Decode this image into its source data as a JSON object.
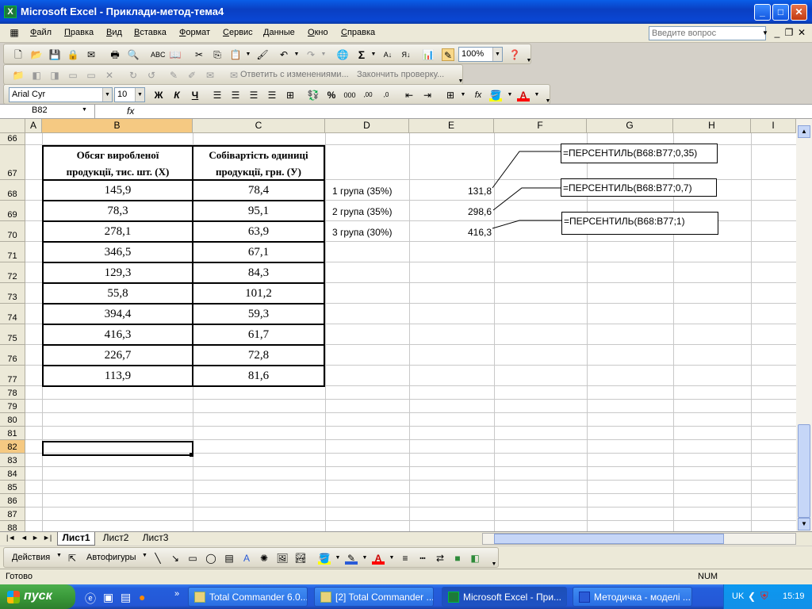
{
  "window": {
    "title": "Microsoft Excel - Приклади-метод-тема4",
    "app_icon": "excel-icon"
  },
  "menu": {
    "items": [
      "Файл",
      "Правка",
      "Вид",
      "Вставка",
      "Формат",
      "Сервис",
      "Данные",
      "Окно",
      "Справка"
    ],
    "help_placeholder": "Введите вопрос"
  },
  "toolbar": {
    "zoom": "100%",
    "review_reply": "Ответить с изменениями...",
    "review_end": "Закончить проверку...",
    "font": "Arial Cyr",
    "font_size": "10",
    "bold": "Ж",
    "italic": "К",
    "underline": "Ч",
    "fx": "fx"
  },
  "formula_bar": {
    "name_box": "B82",
    "content": ""
  },
  "columns": [
    "A",
    "B",
    "C",
    "D",
    "E",
    "F",
    "G",
    "H",
    "I"
  ],
  "rows": [
    "66",
    "67",
    "68",
    "69",
    "70",
    "71",
    "72",
    "73",
    "74",
    "75",
    "76",
    "77",
    "78",
    "79",
    "80",
    "81",
    "82",
    "83",
    "84",
    "85",
    "86",
    "87",
    "88"
  ],
  "table": {
    "header_b": [
      "Обсяг виробленої",
      "продукції, тис. шт. (Х)"
    ],
    "header_c": [
      "Собівартість одиниці",
      "продукції, грн. (У)"
    ],
    "rows": [
      [
        "145,9",
        "78,4"
      ],
      [
        "78,3",
        "95,1"
      ],
      [
        "278,1",
        "63,9"
      ],
      [
        "346,5",
        "67,1"
      ],
      [
        "129,3",
        "84,3"
      ],
      [
        "55,8",
        "101,2"
      ],
      [
        "394,4",
        "59,3"
      ],
      [
        "416,3",
        "61,7"
      ],
      [
        "226,7",
        "72,8"
      ],
      [
        "113,9",
        "81,6"
      ]
    ]
  },
  "groups": [
    {
      "label": "1 група (35%)",
      "value": "131,8",
      "formula": "=ПЕРСЕНТИЛЬ(B68:B77;0,35)"
    },
    {
      "label": "2 група (35%)",
      "value": "298,6",
      "formula": "=ПЕРСЕНТИЛЬ(B68:B77;0,7)"
    },
    {
      "label": "3 група (30%)",
      "value": "416,3",
      "formula": "=ПЕРСЕНТИЛЬ(B68:B77;1)"
    }
  ],
  "sheets": [
    "Лист1",
    "Лист2",
    "Лист3"
  ],
  "drawing": {
    "actions": "Действия",
    "autoshapes": "Автофигуры"
  },
  "status": {
    "left": "Готово",
    "num": "NUM"
  },
  "taskbar": {
    "start": "пуск",
    "tasks": [
      "Total Commander 6.0...",
      "[2] Total Commander ...",
      "Microsoft Excel - При...",
      "Методичка - моделі ..."
    ],
    "lang": "UK",
    "clock": "15:19"
  },
  "colors": {
    "accent": "#0a3fc2",
    "taskbar": "#245edc",
    "start": "#3a9a3a",
    "selection": "#000000"
  }
}
